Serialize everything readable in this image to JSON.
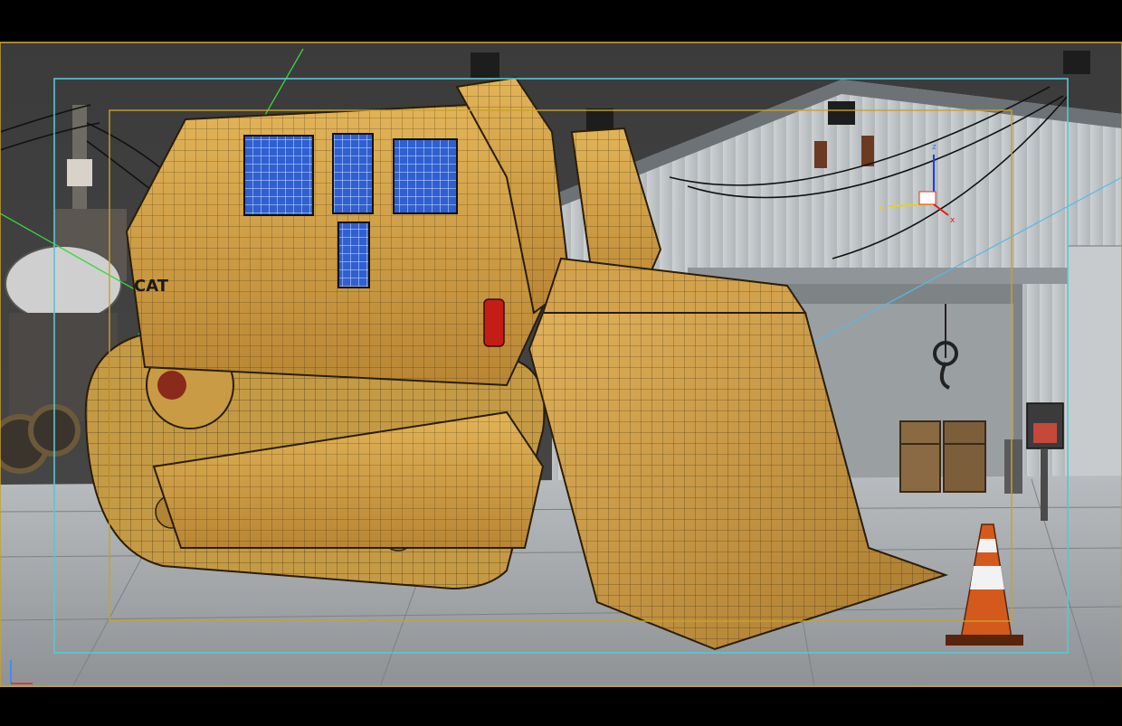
{
  "viewport": {
    "background_color": "#3a3a3a",
    "safe_frame_color": "#58c7d6",
    "action_frame_color": "#c9a227",
    "outer_frame_color": "#c9a227"
  },
  "scene": {
    "bulldozer_color": "#d8a74a",
    "wire_color": "#1a1a1a",
    "floor_color": "#a9adb0",
    "cone_color": "#d35a1c"
  },
  "gizmo": {
    "x_label": "x",
    "y_label": "y",
    "z_label": "z"
  },
  "hangar_sign": {
    "brand_text": "CAT"
  }
}
